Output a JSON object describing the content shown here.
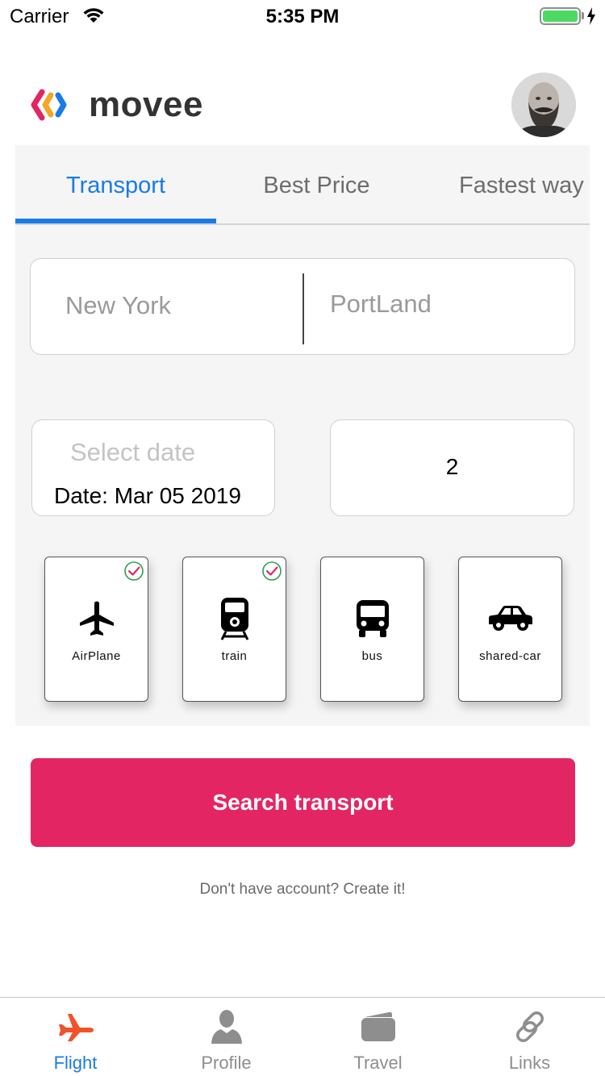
{
  "status_bar": {
    "carrier": "Carrier",
    "time": "5:35 PM",
    "battery_color": "#4cd964"
  },
  "header": {
    "logo_text": "movee",
    "logo_icon": "movee-logo-icon",
    "avatar_icon": "user-avatar"
  },
  "tabs": [
    {
      "label": "Transport",
      "active": true
    },
    {
      "label": "Best Price",
      "active": false
    },
    {
      "label": "Fastest way",
      "active": false
    }
  ],
  "route": {
    "from_placeholder": "New York",
    "to_placeholder": "PortLand"
  },
  "date": {
    "placeholder": "Select date",
    "value": "Date: Mar 05 2019"
  },
  "passengers": {
    "value": "2"
  },
  "modes": [
    {
      "label": "AirPlane",
      "icon": "airplane-icon",
      "selected": true
    },
    {
      "label": "train",
      "icon": "train-icon",
      "selected": true
    },
    {
      "label": "bus",
      "icon": "bus-icon",
      "selected": false
    },
    {
      "label": "shared-car",
      "icon": "car-icon",
      "selected": false
    }
  ],
  "search_button": {
    "label": "Search transport",
    "color": "#e42563"
  },
  "create_account": {
    "text": "Don't have account? Create it!"
  },
  "tabbar": [
    {
      "label": "Flight",
      "icon": "airplane-icon",
      "active": true
    },
    {
      "label": "Profile",
      "icon": "user-icon",
      "active": false
    },
    {
      "label": "Travel",
      "icon": "wallet-icon",
      "active": false
    },
    {
      "label": "Links",
      "icon": "link-icon",
      "active": false
    }
  ],
  "colors": {
    "accent_blue": "#1a7be6",
    "accent_pink": "#e42563",
    "flight_tab_icon": "#f0522a"
  }
}
